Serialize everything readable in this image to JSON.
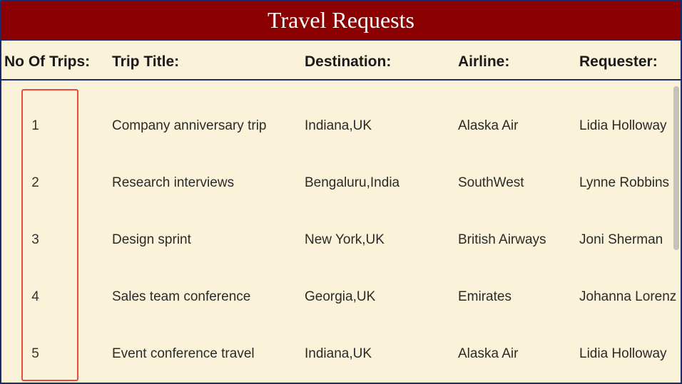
{
  "title": "Travel Requests",
  "headers": {
    "no": "No Of Trips:",
    "title": "Trip Title:",
    "dest": "Destination:",
    "air": "Airline:",
    "req": "Requester:"
  },
  "rows": [
    {
      "no": "1",
      "title": "Company anniversary trip",
      "dest": "Indiana,UK",
      "air": "Alaska Air",
      "req": "Lidia Holloway"
    },
    {
      "no": "2",
      "title": "Research interviews",
      "dest": "Bengaluru,India",
      "air": "SouthWest",
      "req": "Lynne Robbins"
    },
    {
      "no": "3",
      "title": "Design sprint",
      "dest": "New York,UK",
      "air": "British Airways",
      "req": "Joni Sherman"
    },
    {
      "no": "4",
      "title": "Sales team conference",
      "dest": "Georgia,UK",
      "air": "Emirates",
      "req": "Johanna Lorenz"
    },
    {
      "no": "5",
      "title": "Event conference travel",
      "dest": "Indiana,UK",
      "air": "Alaska Air",
      "req": "Lidia Holloway"
    }
  ]
}
